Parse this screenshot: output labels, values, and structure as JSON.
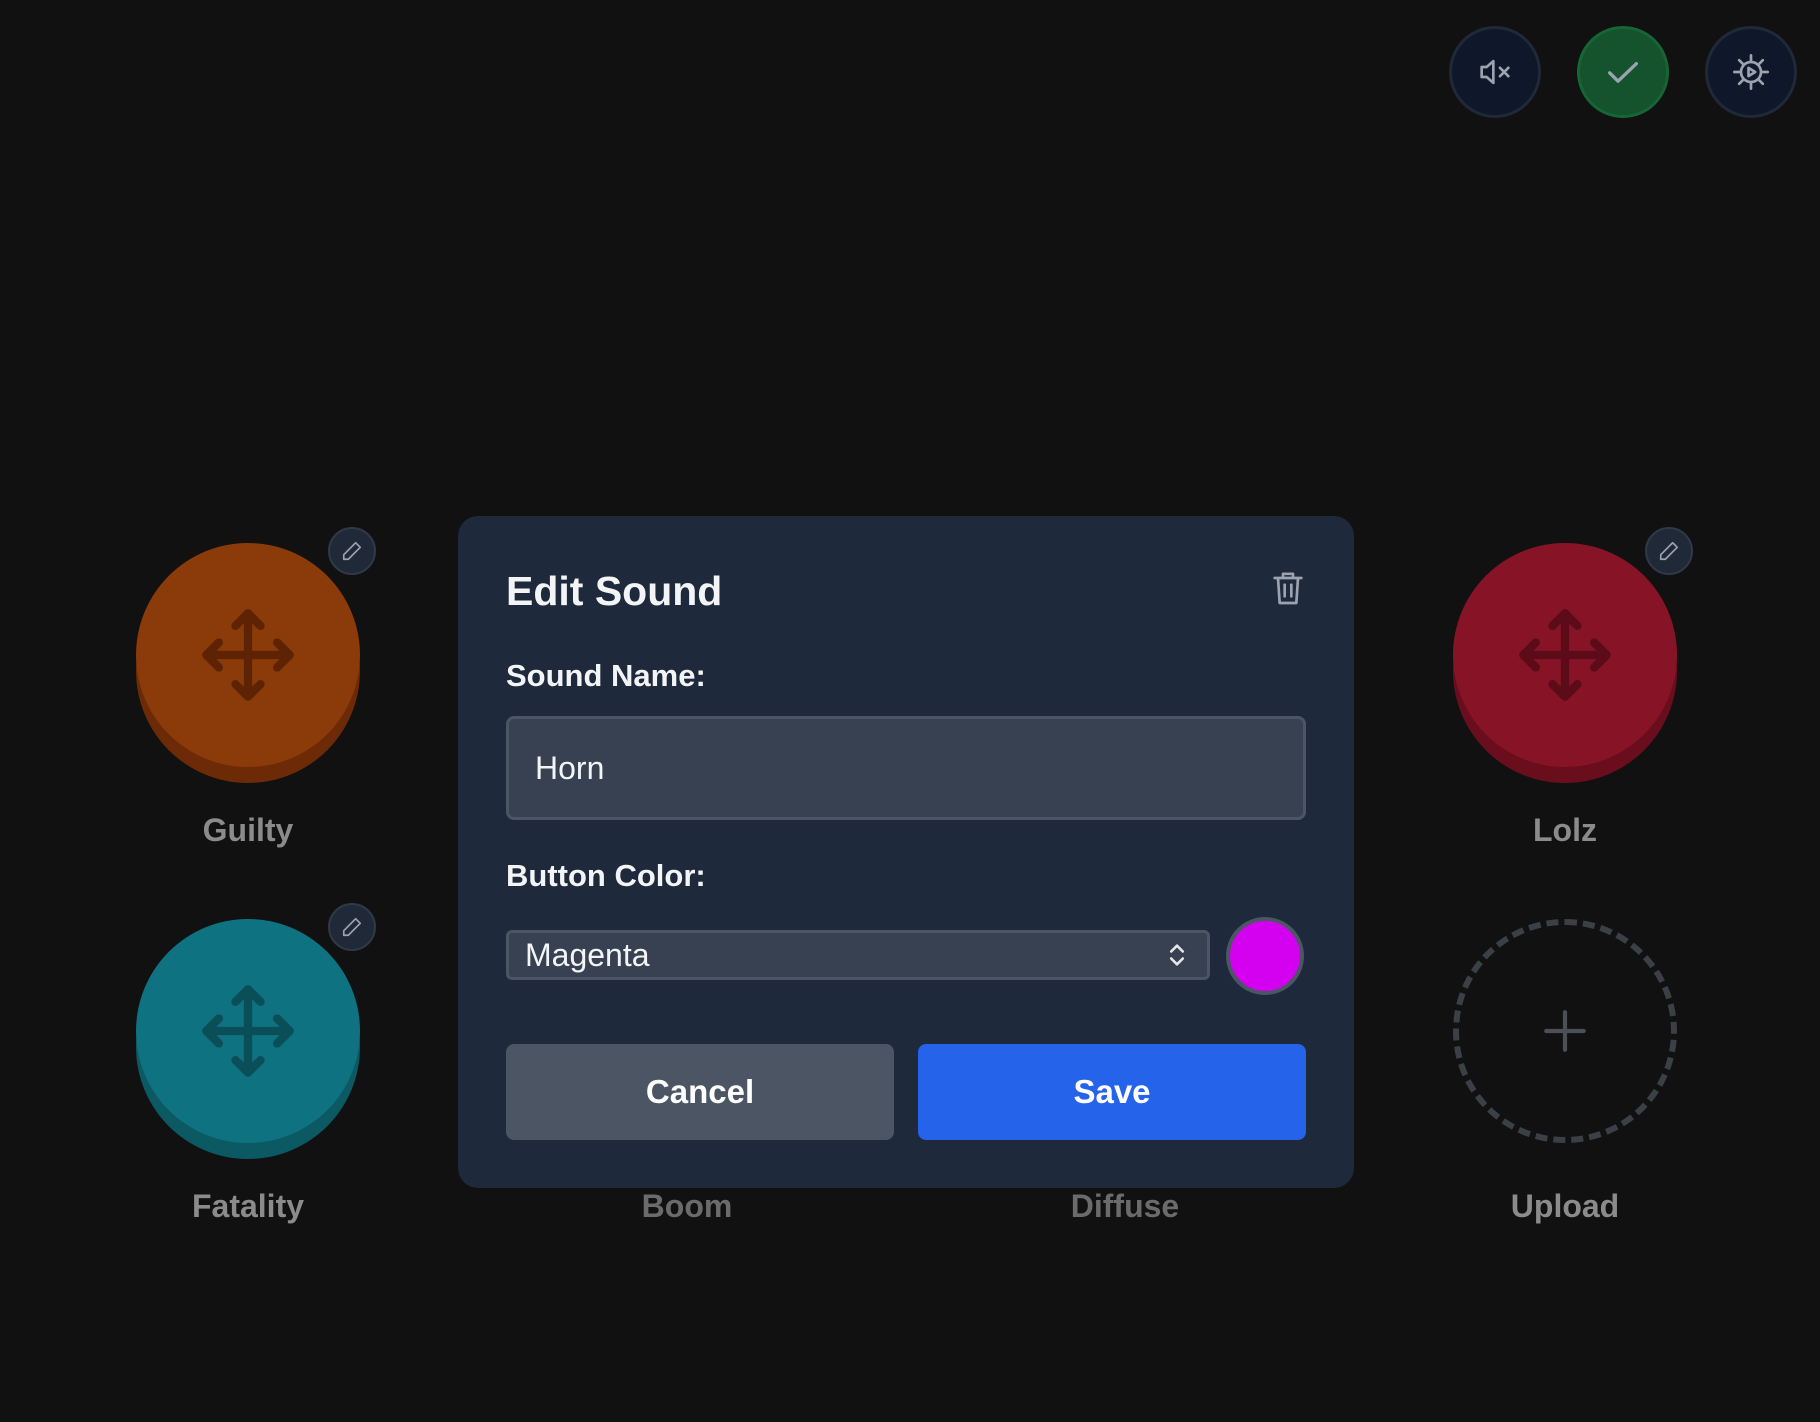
{
  "toolbar": {
    "mute_icon": "speaker-muted-icon",
    "done_icon": "checkmark-icon",
    "settings_icon": "gear-icon"
  },
  "pads": [
    {
      "label": "Guilty",
      "color": "#8b3a09",
      "shade": "#6d2a06",
      "icon": "move-icon"
    },
    {
      "label": "Lolz",
      "color": "#871326",
      "shade": "#6a0e1d",
      "icon": "move-icon"
    },
    {
      "label": "Fatality",
      "color": "#0f7280",
      "shade": "#0b5963",
      "icon": "move-icon"
    }
  ],
  "hidden_labels": [
    "Boom",
    "Diffuse"
  ],
  "upload": {
    "label": "Upload",
    "icon": "plus-icon"
  },
  "modal": {
    "title": "Edit Sound",
    "delete_icon": "trash-icon",
    "name_label": "Sound Name:",
    "name_value": "Horn",
    "color_label": "Button Color:",
    "color_value": "Magenta",
    "swatch_color": "#d400f0",
    "cancel_label": "Cancel",
    "save_label": "Save"
  }
}
